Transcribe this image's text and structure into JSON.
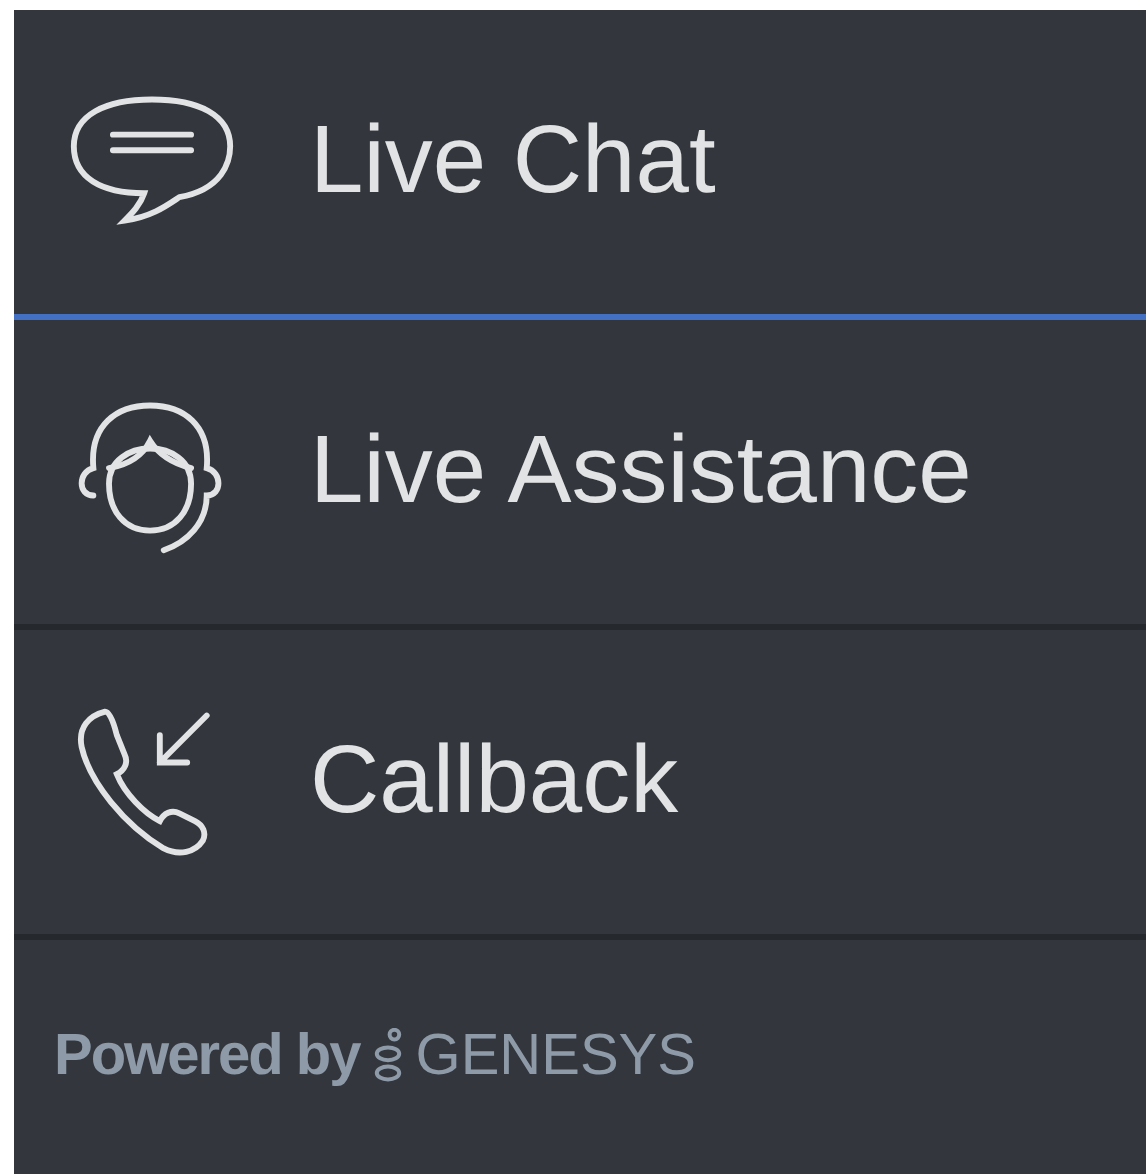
{
  "menu": [
    {
      "kind": "chat",
      "label": "Live Chat",
      "selected": true
    },
    {
      "kind": "agent",
      "label": "Live Assistance",
      "selected": false
    },
    {
      "kind": "callback",
      "label": "Callback",
      "selected": false
    }
  ],
  "footer": {
    "powered_by": "Powered by",
    "brand": "GENESYS"
  }
}
